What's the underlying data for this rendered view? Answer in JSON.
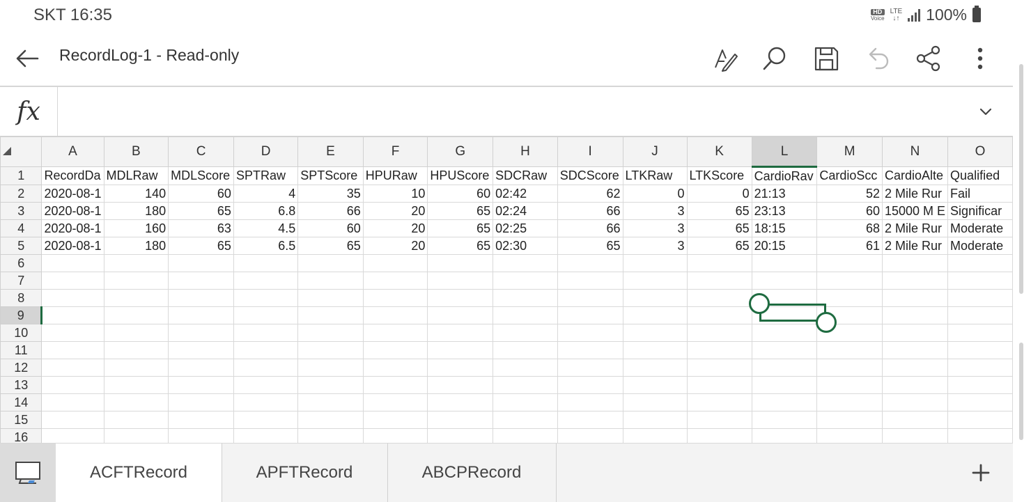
{
  "status_bar": {
    "carrier_time": "SKT 16:35",
    "hd_label": "HD",
    "voice_label": "Voice",
    "lte_label": "LTE",
    "battery": "100%"
  },
  "title_bar": {
    "title": "RecordLog-1 - Read-only",
    "icons": [
      "back-arrow-icon",
      "pen-edit-icon",
      "search-icon",
      "save-icon",
      "undo-icon",
      "share-icon",
      "more-icon"
    ]
  },
  "formula_bar": {
    "fx": "fx",
    "value": ""
  },
  "columns": [
    "A",
    "B",
    "C",
    "D",
    "E",
    "F",
    "G",
    "H",
    "I",
    "J",
    "K",
    "L",
    "M",
    "N",
    "O"
  ],
  "selected_column": "L",
  "selected_row": "9",
  "row_numbers": [
    "1",
    "2",
    "3",
    "4",
    "5",
    "6",
    "7",
    "8",
    "9",
    "10",
    "11",
    "12",
    "13",
    "14",
    "15",
    "16"
  ],
  "rows": [
    [
      "RecordDa",
      "MDLRaw",
      "MDLScore",
      "SPTRaw",
      "SPTScore",
      "HPURaw",
      "HPUScore",
      "SDCRaw",
      "SDCScore",
      "LTKRaw",
      "LTKScore",
      "CardioRav",
      "CardioScc",
      "CardioAlte",
      "Qualified"
    ],
    [
      "2020-08-1",
      "140",
      "60",
      "4",
      "35",
      "10",
      "60",
      "02:42",
      "62",
      "0",
      "0",
      "21:13",
      "52",
      "2 Mile Rur",
      "Fail"
    ],
    [
      "2020-08-1",
      "180",
      "65",
      "6.8",
      "66",
      "20",
      "65",
      "02:24",
      "66",
      "3",
      "65",
      "23:13",
      "60",
      "15000 M E",
      "Significar"
    ],
    [
      "2020-08-1",
      "160",
      "63",
      "4.5",
      "60",
      "20",
      "65",
      "02:25",
      "66",
      "3",
      "65",
      "18:15",
      "68",
      "2 Mile Rur",
      "Moderate"
    ],
    [
      "2020-08-1",
      "180",
      "65",
      "6.5",
      "65",
      "20",
      "65",
      "02:30",
      "65",
      "3",
      "65",
      "20:15",
      "61",
      "2 Mile Rur",
      "Moderate"
    ],
    [
      "",
      "",
      "",
      "",
      "",
      "",
      "",
      "",
      "",
      "",
      "",
      "",
      "",
      "",
      ""
    ],
    [
      "",
      "",
      "",
      "",
      "",
      "",
      "",
      "",
      "",
      "",
      "",
      "",
      "",
      "",
      ""
    ],
    [
      "",
      "",
      "",
      "",
      "",
      "",
      "",
      "",
      "",
      "",
      "",
      "",
      "",
      "",
      ""
    ],
    [
      "",
      "",
      "",
      "",
      "",
      "",
      "",
      "",
      "",
      "",
      "",
      "",
      "",
      "",
      ""
    ],
    [
      "",
      "",
      "",
      "",
      "",
      "",
      "",
      "",
      "",
      "",
      "",
      "",
      "",
      "",
      ""
    ],
    [
      "",
      "",
      "",
      "",
      "",
      "",
      "",
      "",
      "",
      "",
      "",
      "",
      "",
      "",
      ""
    ],
    [
      "",
      "",
      "",
      "",
      "",
      "",
      "",
      "",
      "",
      "",
      "",
      "",
      "",
      "",
      ""
    ],
    [
      "",
      "",
      "",
      "",
      "",
      "",
      "",
      "",
      "",
      "",
      "",
      "",
      "",
      "",
      ""
    ],
    [
      "",
      "",
      "",
      "",
      "",
      "",
      "",
      "",
      "",
      "",
      "",
      "",
      "",
      "",
      ""
    ],
    [
      "",
      "",
      "",
      "",
      "",
      "",
      "",
      "",
      "",
      "",
      "",
      "",
      "",
      "",
      ""
    ],
    [
      "",
      "",
      "",
      "",
      "",
      "",
      "",
      "",
      "",
      "",
      "",
      "",
      "",
      "",
      ""
    ]
  ],
  "sheet_tabs": [
    {
      "label": "ACFTRecord",
      "active": true
    },
    {
      "label": "APFTRecord",
      "active": false
    },
    {
      "label": "ABCPRecord",
      "active": false
    }
  ],
  "add_sheet_label": "+",
  "colors": {
    "accent": "#1e6b40",
    "header_bg": "#f3f3f3",
    "selected_header_bg": "#d4d4d4"
  }
}
